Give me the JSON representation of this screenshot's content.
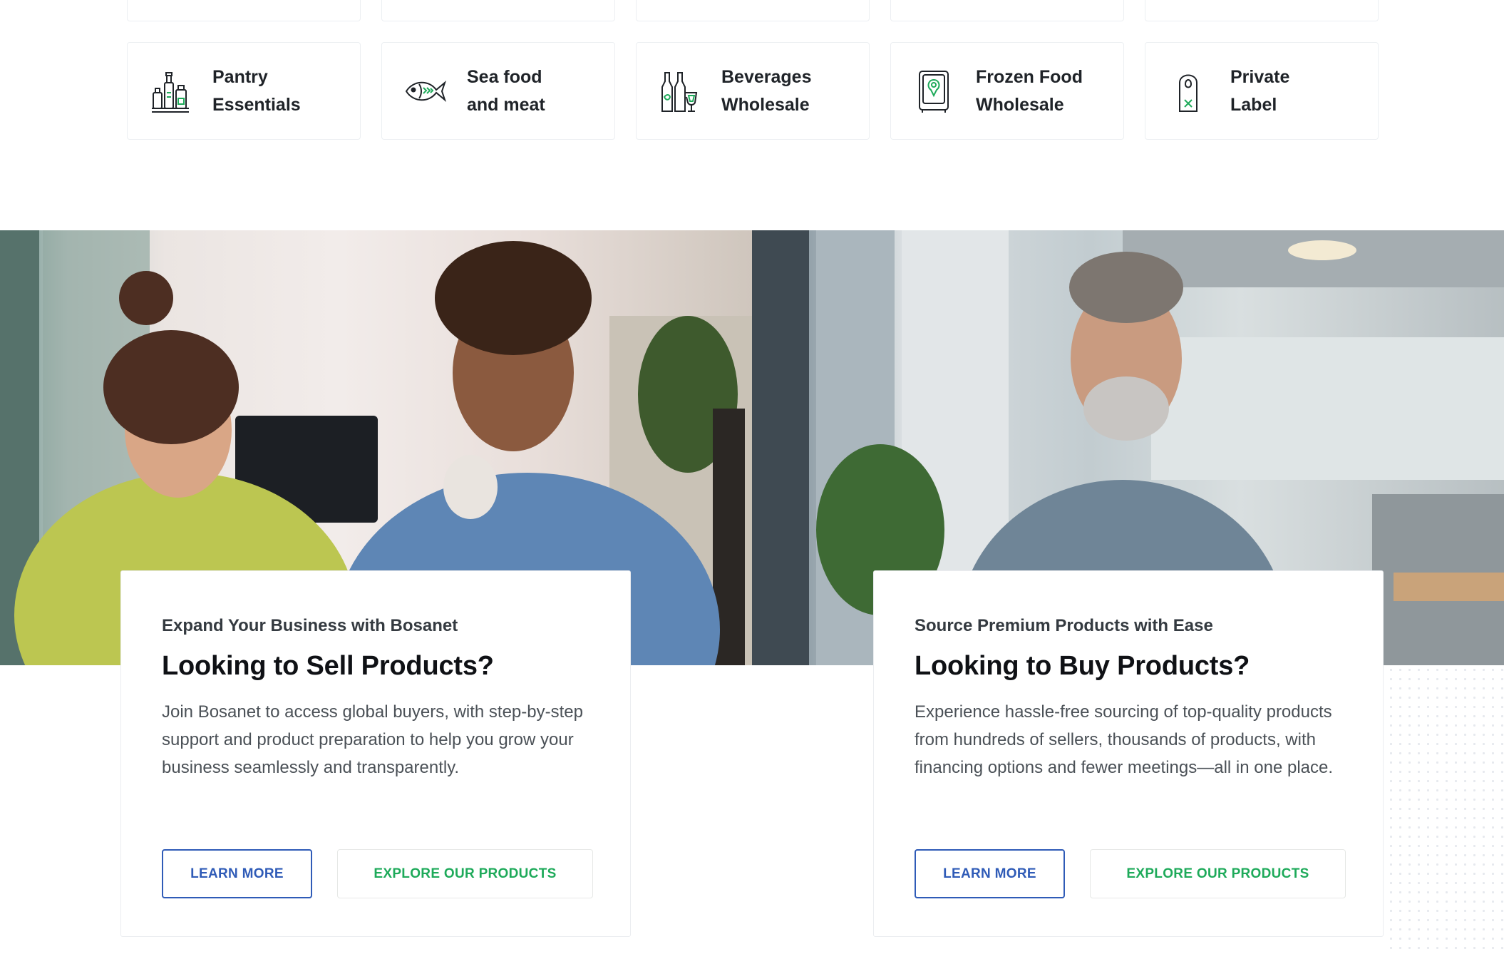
{
  "categories": [
    {
      "label": "Pantry\nEssentials",
      "icon": "pantry-bottles-icon"
    },
    {
      "label": "Sea food\nand meat",
      "icon": "fish-icon"
    },
    {
      "label": "Beverages\nWholesale",
      "icon": "beverage-bottles-icon"
    },
    {
      "label": "Frozen Food\nWholesale",
      "icon": "freezer-icon"
    },
    {
      "label": "Private\nLabel",
      "icon": "door-hanger-tag-icon"
    }
  ],
  "sell": {
    "eyebrow": "Expand Your Business with Bosanet",
    "title": "Looking to Sell Products?",
    "text": "Join Bosanet to access global buyers, with step-by-step support and product preparation to help you grow your business seamlessly and transparently.",
    "learn_label": "LEARN MORE",
    "explore_label": "EXPLORE OUR PRODUCTS"
  },
  "buy": {
    "eyebrow": "Source Premium Products with Ease",
    "title": "Looking to Buy Products?",
    "text": "Experience hassle-free sourcing of top-quality products from hundreds of sellers, thousands of products, with financing options and fewer meetings—all in one place.",
    "learn_label": "LEARN MORE",
    "explore_label": "EXPLORE OUR PRODUCTS"
  },
  "colors": {
    "accent_green": "#1eaa5a",
    "accent_blue": "#2f5bb7",
    "heading": "#0f1115",
    "body_text": "#4b5157"
  }
}
